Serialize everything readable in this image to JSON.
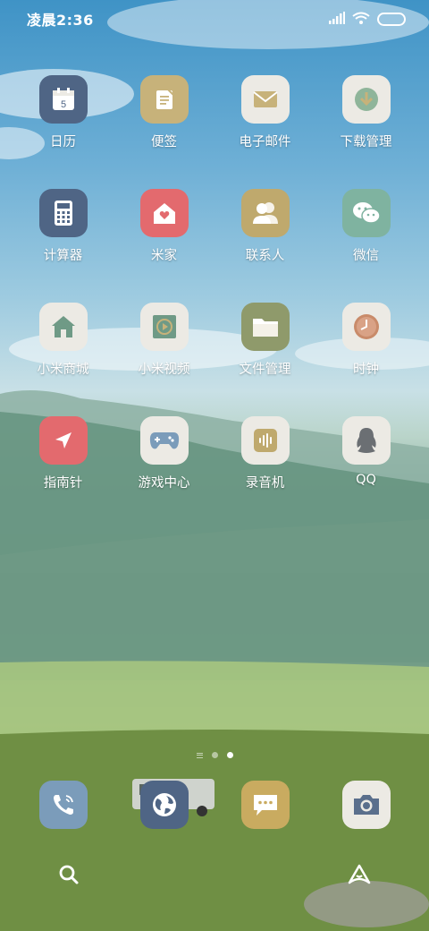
{
  "status_bar": {
    "time": "凌晨2:36",
    "icons": [
      "signal-icon",
      "wifi-icon",
      "battery-icon"
    ]
  },
  "apps": [
    {
      "label": "日历",
      "icon": "calendar-icon",
      "color": "#4f6585",
      "badge_text": "5"
    },
    {
      "label": "便签",
      "icon": "notes-icon",
      "color": "#c7b27a"
    },
    {
      "label": "电子邮件",
      "icon": "mail-icon",
      "color": "#eceae4"
    },
    {
      "label": "下载管理",
      "icon": "download-icon",
      "color": "#eceae4"
    },
    {
      "label": "计算器",
      "icon": "calculator-icon",
      "color": "#4f6585"
    },
    {
      "label": "米家",
      "icon": "home-heart-icon",
      "color": "#e36a6e"
    },
    {
      "label": "联系人",
      "icon": "contacts-icon",
      "color": "#bfa96d"
    },
    {
      "label": "微信",
      "icon": "wechat-icon",
      "color": "#7fb3a0"
    },
    {
      "label": "小米商城",
      "icon": "store-home-icon",
      "color": "#eceae4"
    },
    {
      "label": "小米视频",
      "icon": "video-icon",
      "color": "#eceae4"
    },
    {
      "label": "文件管理",
      "icon": "folder-icon",
      "color": "#8f9a6b"
    },
    {
      "label": "时钟",
      "icon": "clock-icon",
      "color": "#eceae4"
    },
    {
      "label": "指南针",
      "icon": "compass-icon",
      "color": "#e36a6e"
    },
    {
      "label": "游戏中心",
      "icon": "gamepad-icon",
      "color": "#eceae4"
    },
    {
      "label": "录音机",
      "icon": "recorder-icon",
      "color": "#eceae4"
    },
    {
      "label": "QQ",
      "icon": "qq-icon",
      "color": "#eceae4"
    }
  ],
  "page_indicator": {
    "pages": 3,
    "active": 2
  },
  "dock": [
    {
      "icon": "phone-icon",
      "color": "#7b9cba"
    },
    {
      "icon": "browser-icon",
      "color": "#4f6585"
    },
    {
      "icon": "message-icon",
      "color": "#c9ab60"
    },
    {
      "icon": "camera-icon",
      "color": "#eceae4"
    }
  ],
  "bottom_bar": {
    "left": "search-icon",
    "right": "assistant-icon"
  }
}
